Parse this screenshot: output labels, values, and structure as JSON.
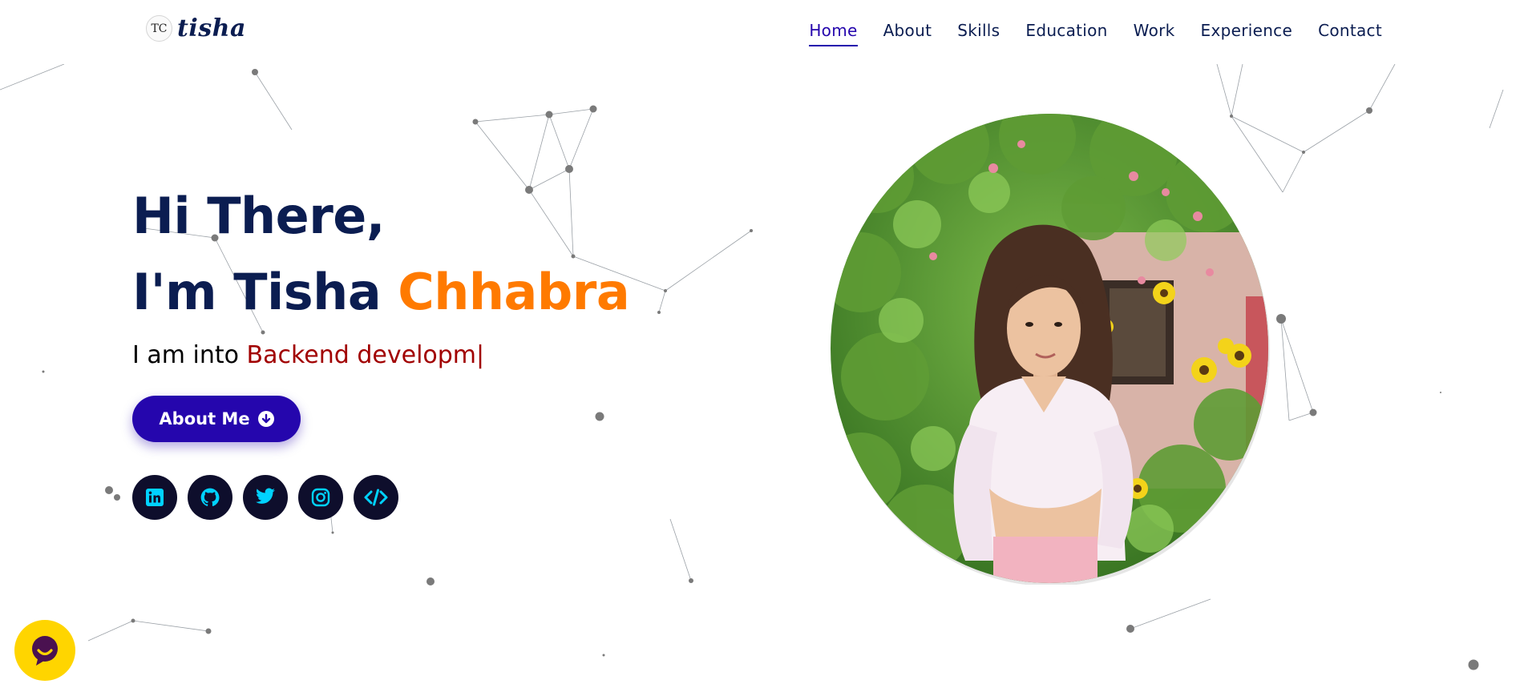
{
  "header": {
    "logo_badge": "TC",
    "logo_word": "tisha",
    "nav": [
      {
        "label": "Home",
        "active": true
      },
      {
        "label": "About"
      },
      {
        "label": "Skills"
      },
      {
        "label": "Education"
      },
      {
        "label": "Work"
      },
      {
        "label": "Experience"
      },
      {
        "label": "Contact"
      }
    ]
  },
  "hero": {
    "greeting": "Hi There,",
    "intro_prefix": "I'm Tisha",
    "intro_accent": "Chhabra",
    "typed_prefix": "I am into",
    "typed_text": "Backend developm|",
    "about_button": "About Me",
    "socials": [
      {
        "icon": "linkedin-icon"
      },
      {
        "icon": "github-icon"
      },
      {
        "icon": "twitter-icon"
      },
      {
        "icon": "instagram-icon"
      },
      {
        "icon": "code-icon"
      }
    ]
  },
  "colors": {
    "navy": "#0b1d51",
    "accent_orange": "#ff7a00",
    "typed_red": "#a10000",
    "button_blue": "#2506ad",
    "social_icon": "#00d2ff",
    "chat_yellow": "#ffd500"
  },
  "chat_widget": {
    "icon": "chat-bubble-icon"
  }
}
